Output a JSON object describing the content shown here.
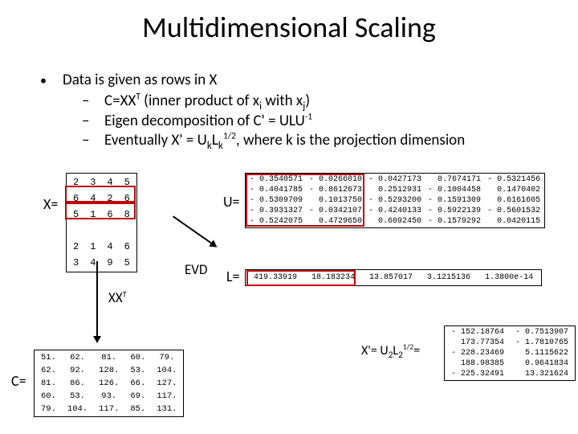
{
  "title": "Multidimensional Scaling",
  "bullets": {
    "main": "Data is given as rows in X",
    "sub1_a": "C=XX",
    "sub1_b": " (inner product of x",
    "sub1_c": " with x",
    "sub1_d": ")",
    "sub2_a": "Eigen decomposition of C' = ULU",
    "sub3_a": "Eventually  X' = U",
    "sub3_b": "L",
    "sub3_c": ", where k is the projection dimension"
  },
  "sup_T": "T",
  "sup_m1": "-1",
  "sup_half": "1/2",
  "sub_i": "i",
  "sub_j": "j",
  "sub_k": "k",
  "sub_2": "2",
  "matrices": {
    "X": {
      "label": "X=",
      "rows": [
        [
          "2",
          "3",
          "4",
          "5"
        ],
        [
          "6",
          "4",
          "2",
          "6"
        ],
        [
          "5",
          "1",
          "6",
          "8"
        ],
        [
          "",
          "",
          "",
          ""
        ],
        [
          "2",
          "1",
          "4",
          "6"
        ],
        [
          "3",
          "4",
          "9",
          "5"
        ]
      ]
    },
    "C": {
      "label": "C=",
      "rows": [
        [
          "51.",
          "62.",
          "81.",
          "60.",
          "79."
        ],
        [
          "62.",
          "92.",
          "128.",
          "53.",
          "104."
        ],
        [
          "81.",
          "86.",
          "126.",
          "66.",
          "127."
        ],
        [
          "60.",
          "53.",
          "93.",
          "69.",
          "117."
        ],
        [
          "79.",
          "104.",
          "117.",
          "85.",
          "131."
        ]
      ]
    },
    "U": {
      "label": "U=",
      "rows": [
        [
          "- 0.3540571",
          "- 0.0266010",
          "- 0.0427173",
          "0.7674171",
          "- 0.5321456"
        ],
        [
          "- 0.4041785",
          "- 0.8612673",
          "0.2512931",
          "- 0.1004458",
          "0.1470402"
        ],
        [
          "- 0.5309709",
          "0.1013750",
          "- 0.5293200",
          "- 0.1591309",
          "0.6161605"
        ],
        [
          "- 0.3931327",
          "- 0.0342107",
          "- 0.4240133",
          "- 0.5922139",
          "- 0.5601532"
        ],
        [
          "- 0.5242075",
          "0.4729650",
          "0.6092450",
          "- 0.1579292",
          "0.0420115"
        ]
      ]
    },
    "L": {
      "label": "L=",
      "rows": [
        [
          "419.33919",
          "18.183234",
          "13.857017",
          "3.1215136",
          "1.3800e-14"
        ]
      ]
    },
    "Xp": {
      "rows": [
        [
          "- 152.18764",
          "- 0.7513907"
        ],
        [
          "173.77354",
          "- 1.7810765"
        ],
        [
          "- 228.23469",
          "5.1115622"
        ],
        [
          "188.98385",
          "0.9641834"
        ],
        [
          "- 225.32491",
          "13.321624"
        ]
      ]
    }
  },
  "evd_label": "EVD",
  "xxt_label_a": "XX",
  "xprime_label_a": "X'= U",
  "xprime_label_b": "L",
  "xprime_label_c": "="
}
